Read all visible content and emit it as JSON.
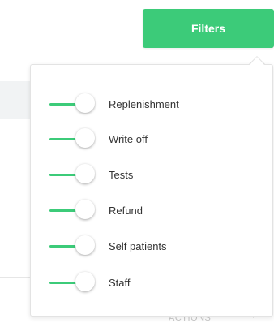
{
  "filters_button": {
    "label": "Filters"
  },
  "filter_options": [
    {
      "label": "Replenishment",
      "enabled": true
    },
    {
      "label": "Write off",
      "enabled": true
    },
    {
      "label": "Tests",
      "enabled": true
    },
    {
      "label": "Refund",
      "enabled": true
    },
    {
      "label": "Self patients",
      "enabled": true
    },
    {
      "label": "Staff",
      "enabled": true
    }
  ],
  "background": {
    "partial_text": "ACTIONS"
  },
  "colors": {
    "accent": "#3ccb79",
    "text": "#333333",
    "panel_border": "#e3e3e3"
  }
}
